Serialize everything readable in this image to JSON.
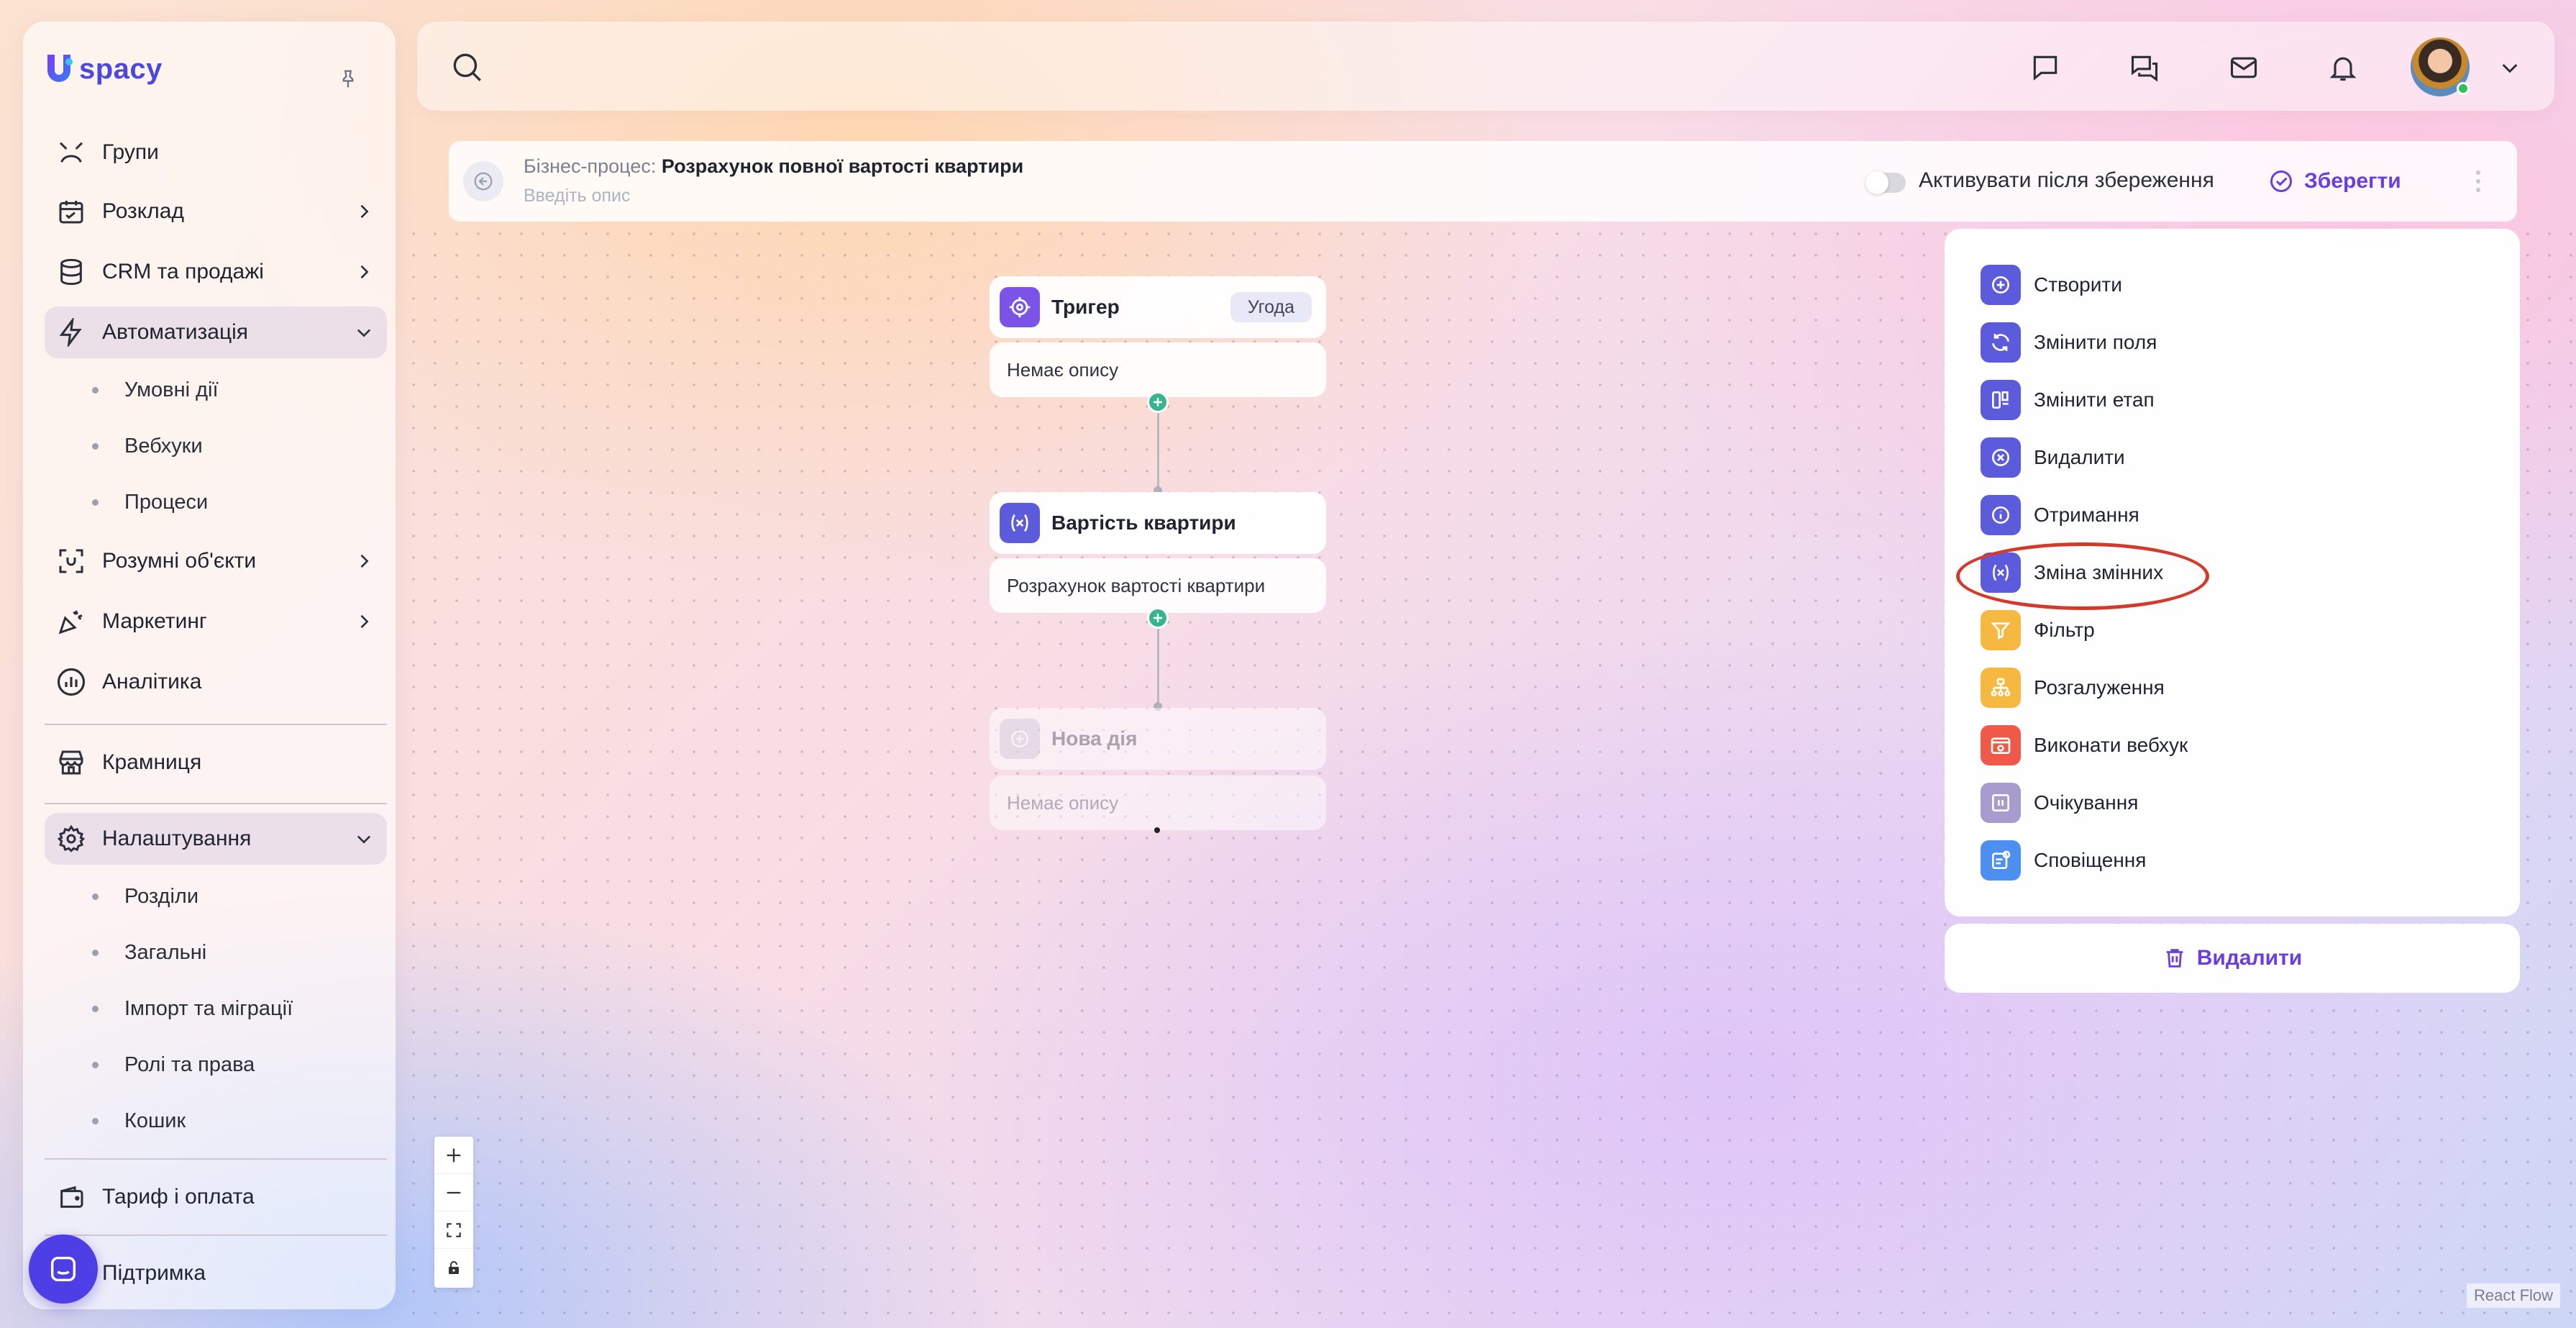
{
  "brand": {
    "logo_text": "spacy",
    "logo_letter": "U"
  },
  "sidebar": {
    "items": [
      {
        "label": "Групи"
      },
      {
        "label": "Розклад"
      },
      {
        "label": "CRM та продажі"
      },
      {
        "label": "Автоматизація",
        "subitems": [
          "Умовні дії",
          "Вебхуки",
          "Процеси"
        ]
      },
      {
        "label": "Розумні об'єкти"
      },
      {
        "label": "Маркетинг"
      },
      {
        "label": "Аналітика"
      },
      {
        "label": "Крамниця"
      },
      {
        "label": "Налаштування",
        "subitems": [
          "Розділи",
          "Загальні",
          "Імпорт та міграції",
          "Ролі та права",
          "Кошик"
        ]
      },
      {
        "label": "Тариф і оплата"
      },
      {
        "label": "Підтримка"
      }
    ]
  },
  "header": {
    "search_placeholder": ""
  },
  "process": {
    "prefix": "Бізнес-процес:",
    "name": "Розрахунок повної вартості квартири",
    "description_placeholder": "Введіть опис",
    "activate_label": "Активувати після збереження",
    "activate_on": false,
    "save_label": "Зберегти"
  },
  "nodes": [
    {
      "title": "Тригер",
      "tag": "Угода",
      "description": "Немає опису"
    },
    {
      "title": "Вартість квартири",
      "description": "Розрахунок вартості квартири"
    },
    {
      "title": "Нова дія",
      "description": "Немає опису"
    }
  ],
  "actions": {
    "items": [
      {
        "label": "Створити",
        "icon": "plus-circle-icon",
        "color": "#5b5bdc"
      },
      {
        "label": "Змінити поля",
        "icon": "refresh-icon",
        "color": "#5b5bdc"
      },
      {
        "label": "Змінити етап",
        "icon": "stage-icon",
        "color": "#5b5bdc"
      },
      {
        "label": "Видалити",
        "icon": "x-circle-icon",
        "color": "#5b5bdc"
      },
      {
        "label": "Отримання",
        "icon": "info-icon",
        "color": "#5b5bdc"
      },
      {
        "label": "Зміна змінних",
        "icon": "variable-icon",
        "color": "#5b5bdc"
      },
      {
        "label": "Фільтр",
        "icon": "filter-icon",
        "color": "#f5b840"
      },
      {
        "label": "Розгалуження",
        "icon": "branch-icon",
        "color": "#f5b840"
      },
      {
        "label": "Виконати вебхук",
        "icon": "webhook-icon",
        "color": "#ef5a48"
      },
      {
        "label": "Очікування",
        "icon": "pause-icon",
        "color": "#a89ccf"
      },
      {
        "label": "Сповіщення",
        "icon": "notification-icon",
        "color": "#4d8ff0"
      }
    ],
    "highlighted": "Зміна змінних",
    "delete_label": "Видалити"
  },
  "footer": {
    "attribution": "React Flow"
  }
}
